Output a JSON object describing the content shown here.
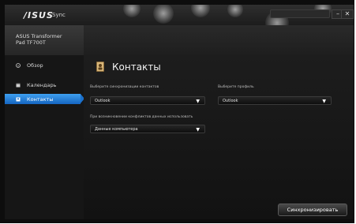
{
  "window": {
    "logo": "/ISUS",
    "app_name": "Sync",
    "controls": {
      "minimize": "–",
      "close": "✕"
    }
  },
  "device": {
    "line1": "ASUS Transformer",
    "line2": "Pad TF700T"
  },
  "sidebar": {
    "items": [
      {
        "label": "Обзор",
        "icon": "info-icon",
        "active": false
      },
      {
        "label": "Календарь",
        "icon": "calendar-icon",
        "active": false
      },
      {
        "label": "Контакты",
        "icon": "contacts-icon",
        "active": true
      }
    ]
  },
  "main": {
    "title": "Контакты",
    "icon": "contacts-book-icon",
    "fields": [
      {
        "label": "Выберите синхронизации контактов",
        "value": "Outlook"
      },
      {
        "label": "Выберите профиль",
        "value": "Outlook"
      },
      {
        "label": "При возникновении конфликтов данных использовать",
        "value": "Данные компьютера"
      }
    ],
    "sync_button": "Синхронизировать"
  },
  "colors": {
    "accent": "#1e7fd8",
    "background": "#141414"
  }
}
